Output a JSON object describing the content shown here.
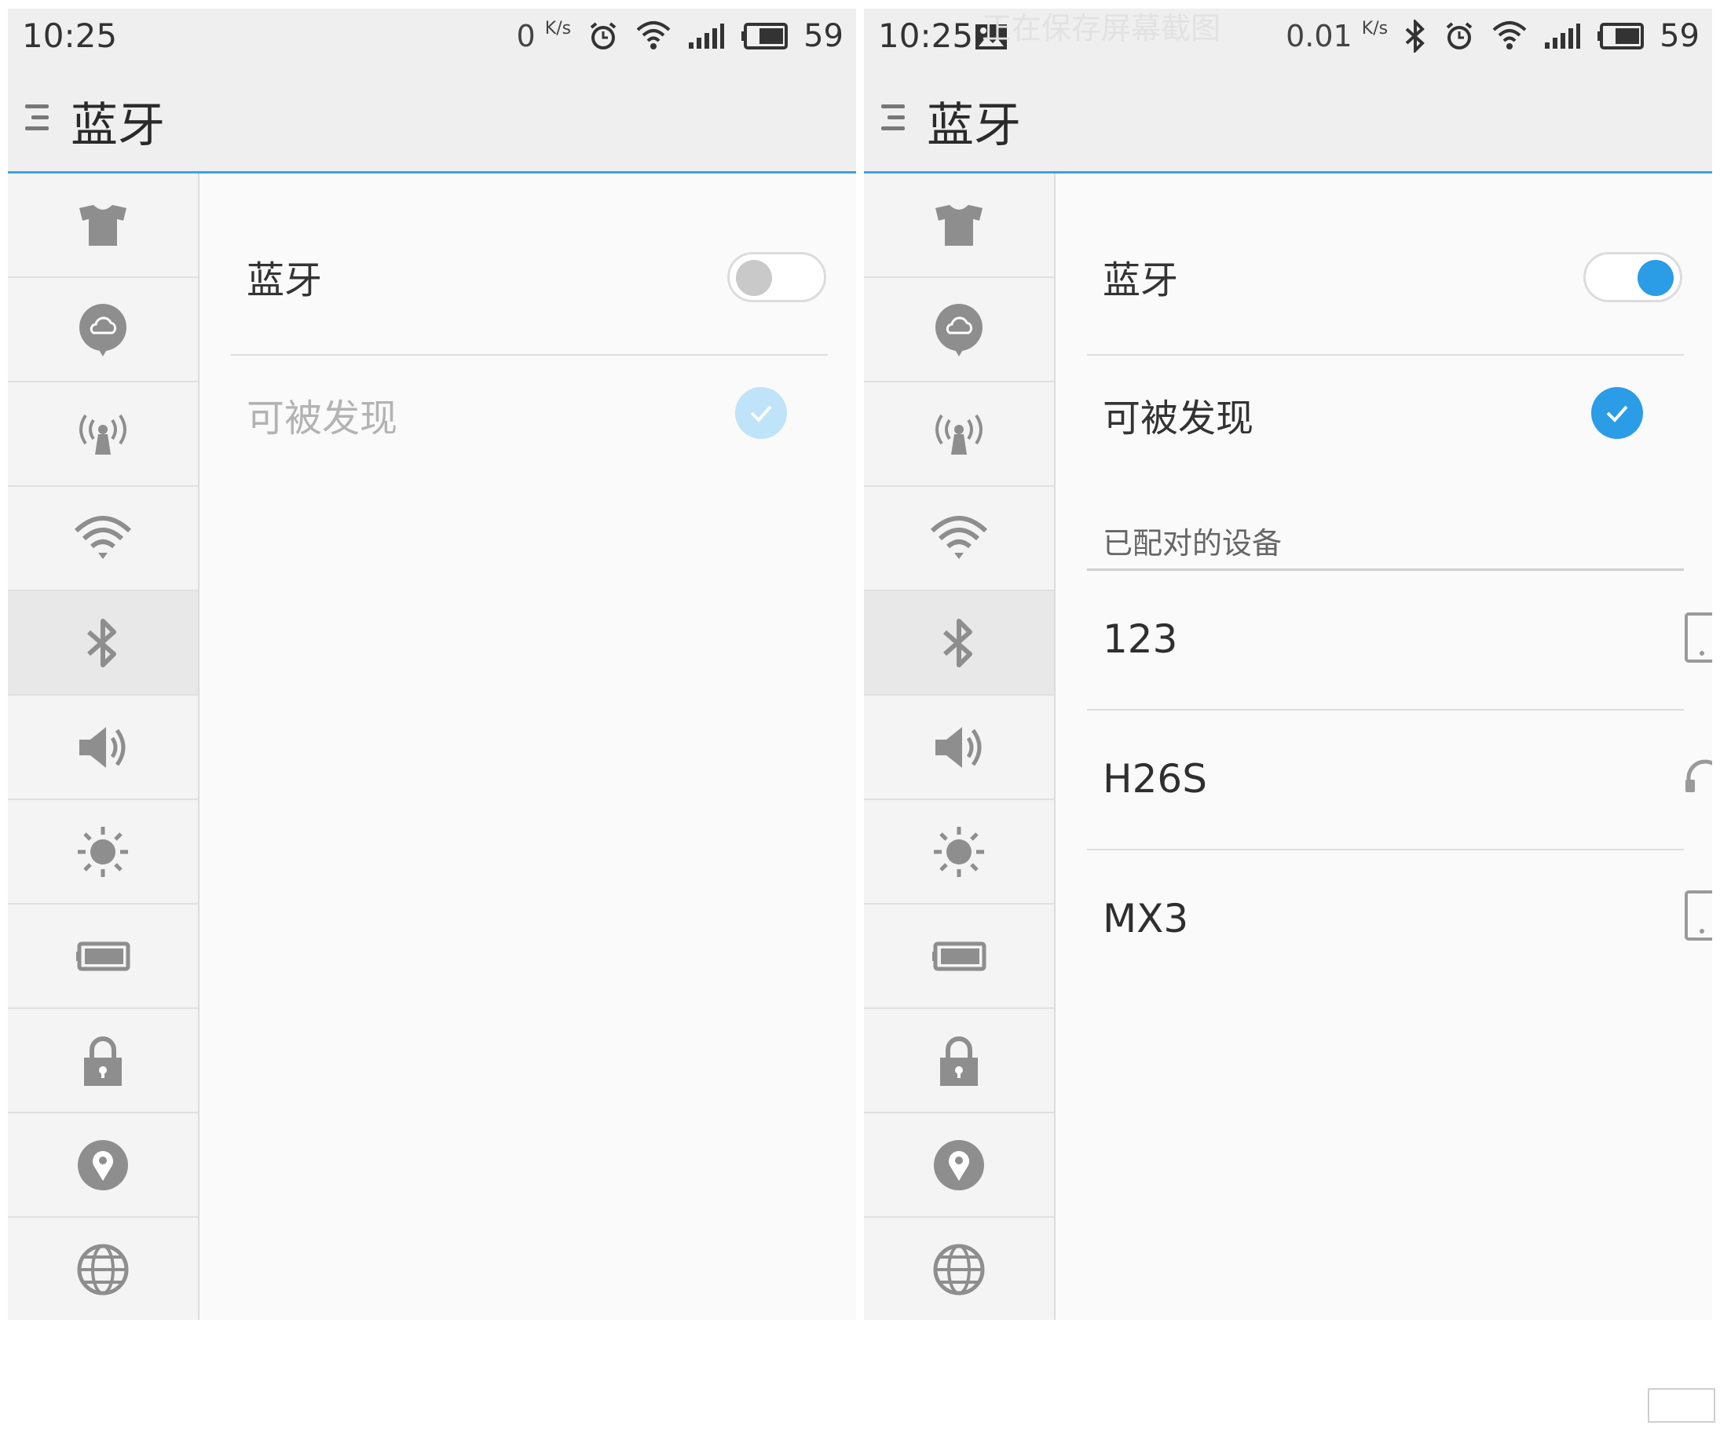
{
  "left": {
    "status": {
      "time": "10:25",
      "speed": "0",
      "speed_unit": "K/s",
      "battery": "59"
    },
    "header": {
      "title": "蓝牙"
    },
    "bluetooth_row": {
      "label": "蓝牙",
      "toggle_state": "off"
    },
    "discoverable_row": {
      "label": "可被发现",
      "checked": true,
      "enabled": false
    }
  },
  "right": {
    "status": {
      "time": "10:25",
      "speed": "0.01",
      "speed_unit": "K/s",
      "battery": "59",
      "notice": "正在保存屏幕截图"
    },
    "header": {
      "title": "蓝牙"
    },
    "bluetooth_row": {
      "label": "蓝牙",
      "toggle_state": "on"
    },
    "discoverable_row": {
      "label": "可被发现",
      "checked": true,
      "enabled": true
    },
    "paired_section": {
      "title": "已配对的设备"
    },
    "devices": [
      {
        "name": "123",
        "icon": "phone-icon"
      },
      {
        "name": "H26S",
        "icon": "headphones-icon"
      },
      {
        "name": "MX3",
        "icon": "phone-icon"
      }
    ]
  },
  "sidebar_icons": [
    "theme-shirt-icon",
    "cloud-icon",
    "hotspot-icon",
    "wifi-icon",
    "bluetooth-icon",
    "sound-icon",
    "brightness-icon",
    "battery-icon",
    "lock-icon",
    "location-icon",
    "globe-icon"
  ],
  "colors": {
    "accent": "#2b9ce6",
    "accent_light": "#bfe3f8",
    "titlebar_line": "#3da3e3",
    "icon_gray": "#8e8e8e"
  }
}
